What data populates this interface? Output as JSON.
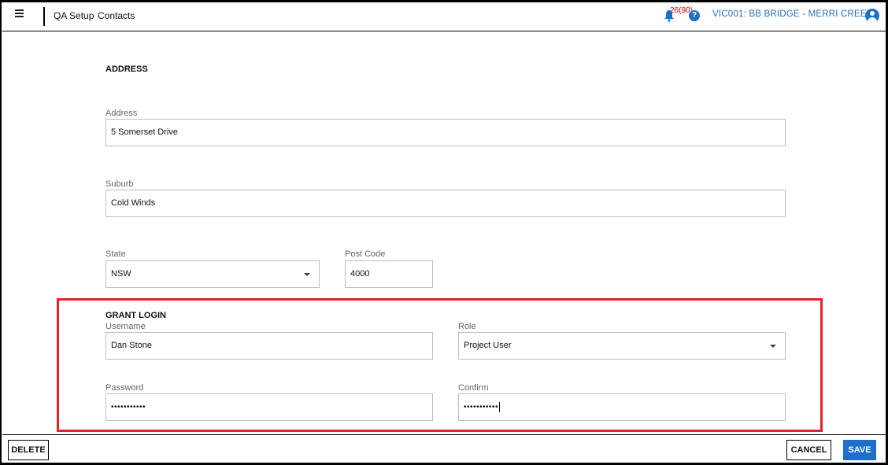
{
  "header": {
    "breadcrumb": [
      "QA Setup",
      "Contacts"
    ],
    "notification_count": "26(90)",
    "help_icon": "?",
    "site_name": "VIC001: BB BRIDGE - MERRI CREEK"
  },
  "address_section": {
    "title": "ADDRESS",
    "address": {
      "label": "Address",
      "value": "5 Somerset Drive"
    },
    "suburb": {
      "label": "Suburb",
      "value": "Cold Winds"
    },
    "state": {
      "label": "State",
      "value": "NSW"
    },
    "post_code": {
      "label": "Post Code",
      "value": "4000"
    }
  },
  "grant_login": {
    "title": "GRANT LOGIN",
    "username": {
      "label": "Username",
      "value": "Dan Stone"
    },
    "role": {
      "label": "Role",
      "value": "Project User"
    },
    "password": {
      "label": "Password",
      "value": "•••••••••••"
    },
    "confirm": {
      "label": "Confirm",
      "value": "•••••••••••"
    }
  },
  "footer": {
    "delete_label": "DELETE",
    "cancel_label": "CANCEL",
    "save_label": "SAVE"
  },
  "colors": {
    "accent": "#1e6fc9",
    "highlight": "#e0232d",
    "notification": "#d00000"
  },
  "icons": {
    "menu": "hamburger-icon",
    "notifications": "bell-icon",
    "help": "help-icon",
    "account": "user-circle-icon",
    "dropdown": "caret-down-icon"
  }
}
